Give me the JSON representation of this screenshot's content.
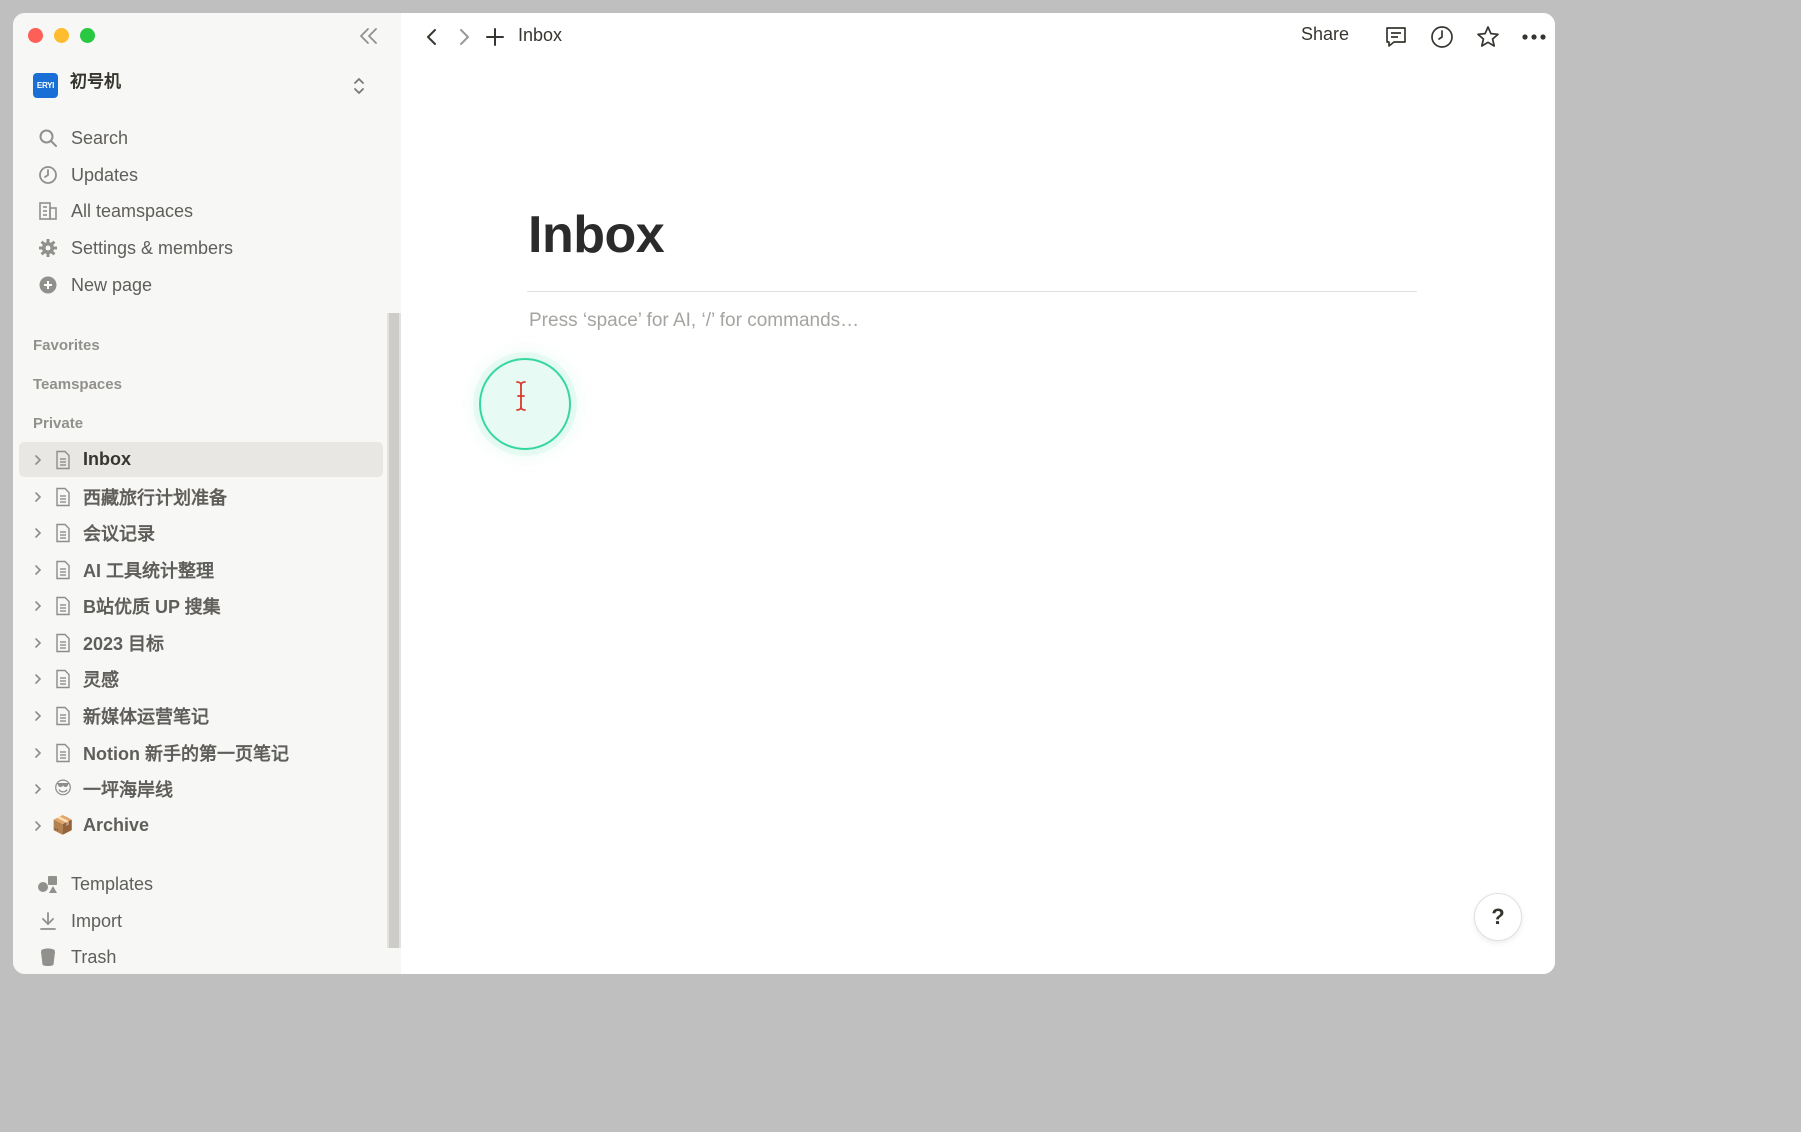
{
  "colors": {
    "sidebar_bg": "#f7f7f5",
    "active_row": "#e8e7e4",
    "text": "#37352f",
    "muted": "#91908c",
    "workspace_logo": "#1a6fd6",
    "cursor_highlight": "#36d6a0"
  },
  "workspace": {
    "logo_text": "ERYI",
    "name": "初号机"
  },
  "nav": [
    {
      "label": "Search",
      "icon": "search-icon"
    },
    {
      "label": "Updates",
      "icon": "clock-icon"
    },
    {
      "label": "All teamspaces",
      "icon": "building-icon"
    },
    {
      "label": "Settings & members",
      "icon": "gear-icon"
    },
    {
      "label": "New page",
      "icon": "plus-circle-icon"
    }
  ],
  "sections": {
    "favorites": "Favorites",
    "teamspaces": "Teamspaces",
    "private": "Private"
  },
  "pages": [
    {
      "label": "Inbox",
      "icon": "page-icon",
      "active": true
    },
    {
      "label": "西藏旅行计划准备",
      "icon": "page-icon"
    },
    {
      "label": "会议记录",
      "icon": "page-icon"
    },
    {
      "label": "AI 工具统计整理",
      "icon": "page-icon"
    },
    {
      "label": "B站优质 UP 搜集",
      "icon": "page-icon"
    },
    {
      "label": "2023 目标",
      "icon": "page-icon"
    },
    {
      "label": "灵感",
      "icon": "page-icon"
    },
    {
      "label": "新媒体运营笔记",
      "icon": "page-icon"
    },
    {
      "label": "Notion 新手的第一页笔记",
      "icon": "page-icon"
    },
    {
      "label": "一坪海岸线",
      "icon": "sunglasses-emoji-icon",
      "emoji": "😎"
    },
    {
      "label": "Archive",
      "icon": "package-emoji-icon",
      "emoji": "📦"
    }
  ],
  "footer_nav": [
    {
      "label": "Templates",
      "icon": "templates-icon"
    },
    {
      "label": "Import",
      "icon": "import-icon"
    },
    {
      "label": "Trash",
      "icon": "trash-icon"
    }
  ],
  "topbar": {
    "breadcrumb": "Inbox",
    "share_label": "Share"
  },
  "page": {
    "title": "Inbox",
    "placeholder": "Press ‘space’ for AI, ‘/’ for commands…"
  },
  "help": {
    "label": "?"
  }
}
